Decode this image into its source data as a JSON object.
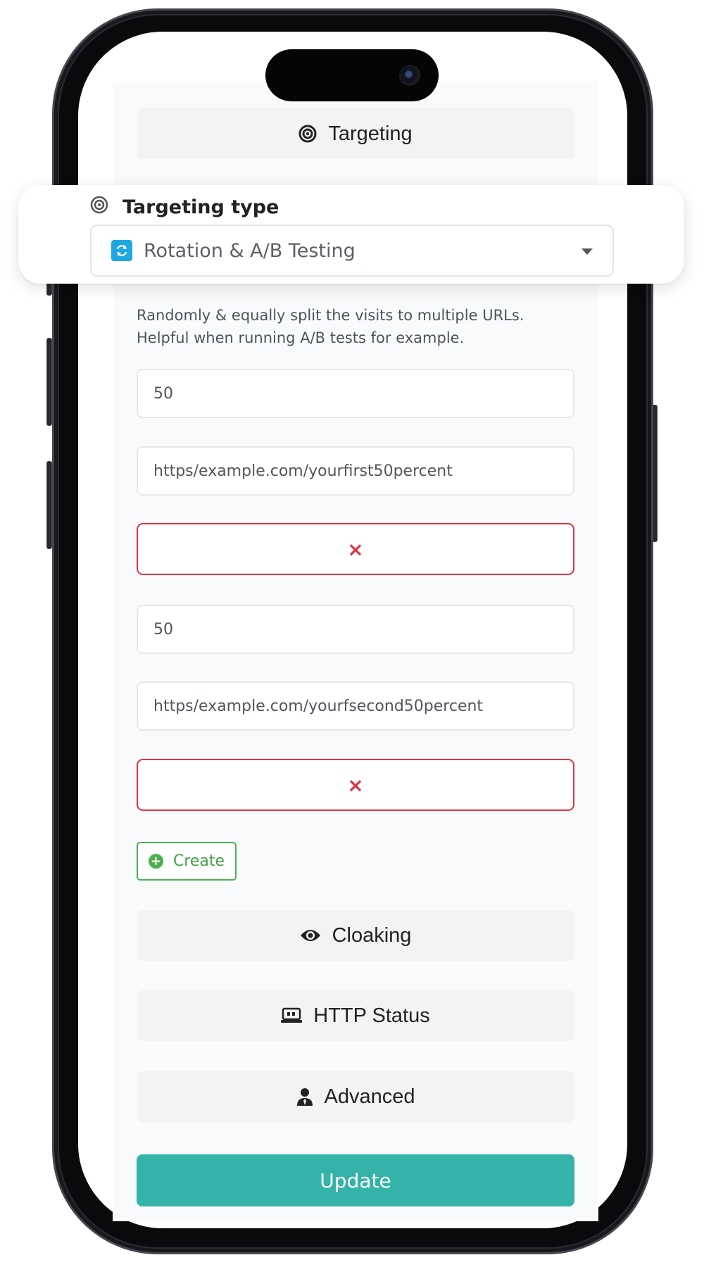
{
  "targeting": {
    "label": "Targeting",
    "icon": "target-icon"
  },
  "targeting_type": {
    "label": "Targeting type",
    "icon": "target-icon",
    "selected": "Rotation & A/B Testing",
    "selected_icon": "rotation-icon"
  },
  "description": "Randomly & equally split the visits to multiple URLs. Helpful when running A/B tests for example.",
  "rules": [
    {
      "percentage": "50",
      "url": "https/example.com/yourfirst50percent",
      "remove_label": "×"
    },
    {
      "percentage": "50",
      "url": "https/example.com/yourfsecond50percent",
      "remove_label": "×"
    }
  ],
  "create": {
    "label": "Create",
    "icon": "plus-circle-icon"
  },
  "cloaking": {
    "label": "Cloaking",
    "icon": "eye-icon"
  },
  "http_status": {
    "label": "HTTP Status",
    "icon": "server-icon"
  },
  "advanced": {
    "label": "Advanced",
    "icon": "user-tie-icon"
  },
  "update": {
    "label": "Update"
  },
  "colors": {
    "accent": "#35b3a9",
    "danger": "#dc3545",
    "success": "#4caf50",
    "info": "#1ea7e1"
  }
}
